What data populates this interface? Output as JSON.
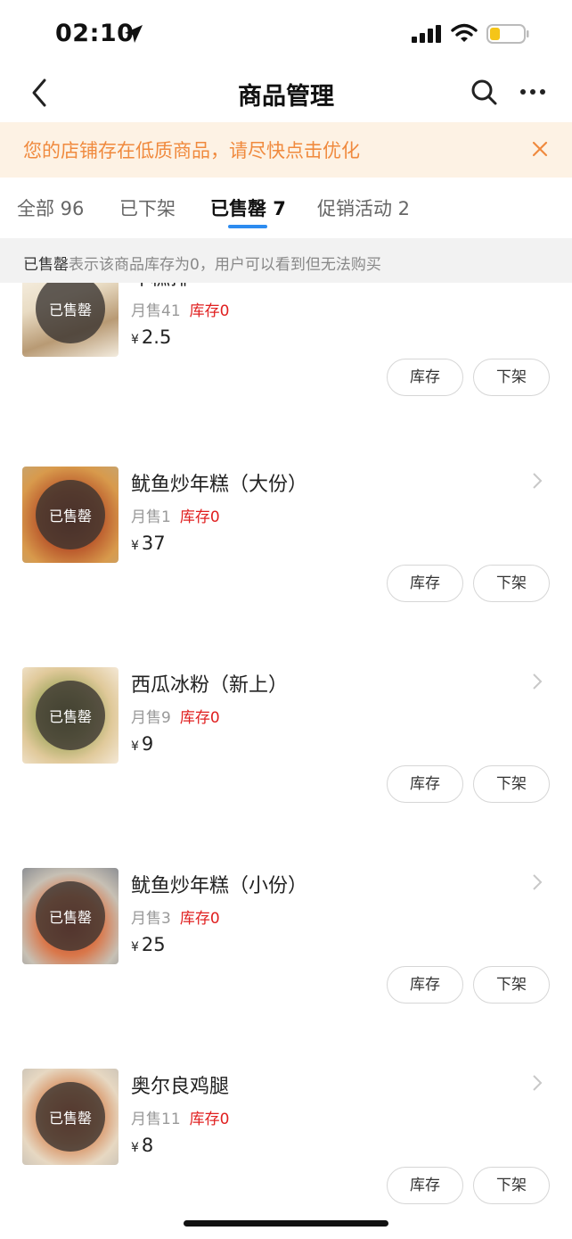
{
  "status_bar": {
    "time": "02:10"
  },
  "nav": {
    "title": "商品管理"
  },
  "notice": {
    "text": "您的店铺存在低质商品，请尽快点击优化"
  },
  "tabs": [
    {
      "label": "全部 96"
    },
    {
      "label": "已下架"
    },
    {
      "label": "已售罄 7",
      "active": true
    },
    {
      "label": "促销活动 2"
    }
  ],
  "info": {
    "strong": "已售罄",
    "text": "表示该商品库存为0，用户可以看到但无法购买"
  },
  "products": [
    {
      "name": "年糕排",
      "sales": "月售41",
      "stock": "库存0",
      "price_symbol": "¥",
      "price": "2.5",
      "badge": "已售罄",
      "btn_stock": "库存",
      "btn_delist": "下架"
    },
    {
      "name": "鱿鱼炒年糕（大份）",
      "sales": "月售1",
      "stock": "库存0",
      "price_symbol": "¥",
      "price": "37",
      "badge": "已售罄",
      "btn_stock": "库存",
      "btn_delist": "下架"
    },
    {
      "name": "西瓜冰粉（新上）",
      "sales": "月售9",
      "stock": "库存0",
      "price_symbol": "¥",
      "price": "9",
      "badge": "已售罄",
      "btn_stock": "库存",
      "btn_delist": "下架"
    },
    {
      "name": "鱿鱼炒年糕（小份）",
      "sales": "月售3",
      "stock": "库存0",
      "price_symbol": "¥",
      "price": "25",
      "badge": "已售罄",
      "btn_stock": "库存",
      "btn_delist": "下架"
    },
    {
      "name": "奥尔良鸡腿",
      "sales": "月售11",
      "stock": "库存0",
      "price_symbol": "¥",
      "price": "8",
      "badge": "已售罄",
      "btn_stock": "库存",
      "btn_delist": "下架"
    }
  ],
  "colors": {
    "accent": "#2d8cf0",
    "notice_text": "#f08a3e",
    "notice_bg": "#fdf2e4",
    "stock_red": "#e02020"
  },
  "icons": [
    "location-arrow-icon",
    "signal-icon",
    "wifi-icon",
    "battery-icon",
    "back-icon",
    "search-icon",
    "more-icon",
    "close-icon",
    "chevron-right-icon"
  ]
}
